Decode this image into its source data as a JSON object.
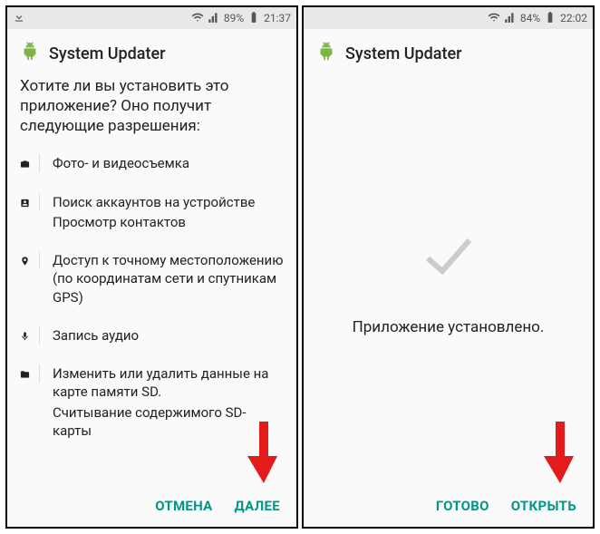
{
  "panes": {
    "left": {
      "statusbar": {
        "battery_pct": "89%",
        "time": "21:37",
        "download_icon": true
      },
      "app_title": "System Updater",
      "prompt": "Хотите ли вы установить это приложение? Оно получит следующие разрешения:",
      "permissions": [
        {
          "icon": "camera",
          "lines": [
            "Фото- и видеосъемка"
          ]
        },
        {
          "icon": "contacts",
          "lines": [
            "Поиск аккаунтов на устройстве",
            "Просмотр контактов"
          ]
        },
        {
          "icon": "location",
          "lines": [
            "Доступ к точному местоположению (по координатам сети и спутникам GPS)"
          ]
        },
        {
          "icon": "mic",
          "lines": [
            "Запись аудио"
          ]
        },
        {
          "icon": "folder",
          "lines": [
            "Изменить или удалить данные на карте памяти SD.",
            "Считывание содержимого SD-карты"
          ]
        }
      ],
      "cancel_label": "ОТМЕНА",
      "next_label": "ДАЛЕЕ"
    },
    "right": {
      "statusbar": {
        "battery_pct": "84%",
        "time": "22:02",
        "download_icon": false
      },
      "app_title": "System Updater",
      "installed_text": "Приложение установлено.",
      "done_label": "ГОТОВО",
      "open_label": "ОТКРЫТЬ"
    }
  },
  "colors": {
    "accent": "#009688",
    "arrow": "#e31b1b"
  }
}
